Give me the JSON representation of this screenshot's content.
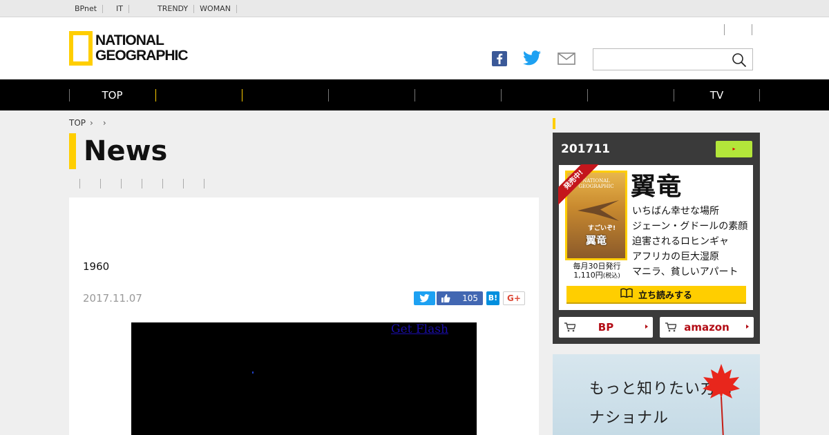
{
  "utility_bar": {
    "links": [
      "BPnet",
      "",
      "IT",
      "",
      "",
      "",
      "TRENDY",
      "WOMAN",
      "",
      "",
      ""
    ]
  },
  "header": {
    "logo_line1": "NATIONAL",
    "logo_line2": "GEOGRAPHIC",
    "search_placeholder": "",
    "icons": [
      "facebook-icon",
      "twitter-icon",
      "mail-icon",
      "search-icon"
    ]
  },
  "nav": {
    "items": [
      "TOP",
      "",
      "",
      "",
      "",
      "",
      "",
      "TV"
    ]
  },
  "breadcrumb": {
    "items": [
      "TOP",
      ""
    ]
  },
  "page": {
    "title": "News"
  },
  "article": {
    "text": "1960",
    "date": "2017.11.07",
    "share": {
      "like_count": "105",
      "hatena_label": "B!",
      "gplus_label": "G+"
    },
    "video": {
      "get_flash": "Get Flash"
    }
  },
  "sidebar": {
    "magazine": {
      "issue": "201711",
      "ribbon": "発売中!",
      "cover_brand_line1": "NATIONAL",
      "cover_brand_line2": "GEOGRAPHIC",
      "cover_tag": "すごいぞ!",
      "cover_title": "翼竜",
      "headline": "翼竜",
      "features": [
        "いちばん幸せな場所",
        "ジェーン・グドールの素顔",
        "迫害されるロヒンギャ",
        "アフリカの巨大湿原",
        "マニラ、貧しいアパート"
      ],
      "pub_line1": "毎月30日発行",
      "pub_line2": "1,110円",
      "pub_tax": "(税込)",
      "read_button": "立ち読みする",
      "store_bp": "BP",
      "store_amazon": "amazon"
    },
    "banner": {
      "line1": "もっと知りたい方は",
      "line2": "ナショナル"
    }
  }
}
